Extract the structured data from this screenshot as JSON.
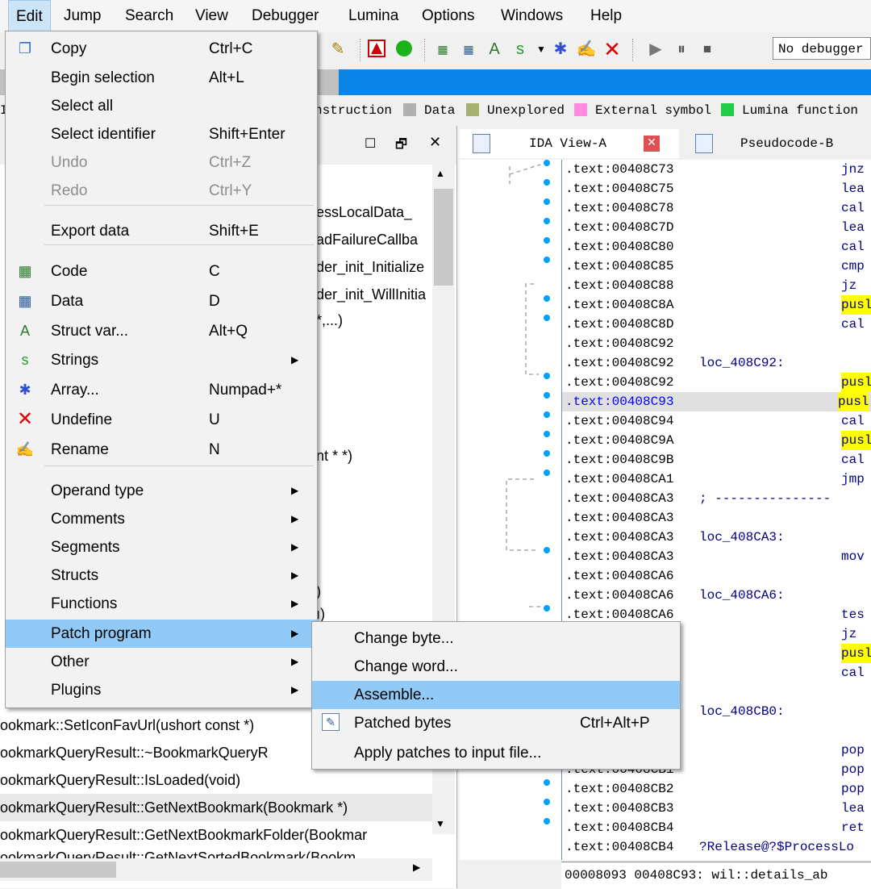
{
  "menubar": {
    "items": [
      "Edit",
      "Jump",
      "Search",
      "View",
      "Debugger",
      "Lumina",
      "Options",
      "Windows",
      "Help"
    ]
  },
  "toolbar": {
    "debugger_select": "No debugger"
  },
  "legend": {
    "items": [
      {
        "label": "nstruction",
        "color": "#c0c0c0"
      },
      {
        "label": "Data",
        "color": "#b0b0b0"
      },
      {
        "label": "Unexplored",
        "color": "#a8b070"
      },
      {
        "label": "External symbol",
        "color": "#ff8ce0"
      },
      {
        "label": "Lumina function",
        "color": "#22cc44"
      }
    ]
  },
  "functions_panel": {
    "partial_rows": [
      "essLocalData_",
      "adFailureCallba",
      "der_init_Initialize",
      "der_init_WillInitia",
      "*,...)",
      "nt * *)",
      ")",
      "ı)"
    ],
    "rows": [
      "ookmark::SetIconFavUrl(ushort const *)",
      "ookmarkQueryResult::~BookmarkQueryR",
      "ookmarkQueryResult::IsLoaded(void)",
      "ookmarkQueryResult::GetNextBookmark(Bookmark *)",
      "ookmarkQueryResult::GetNextBookmarkFolder(Bookmar",
      "ookmarkQueryResult::GetNextSortedBookmark(Bookm"
    ]
  },
  "tabs": [
    {
      "label": "IDA View-A"
    },
    {
      "label": "Pseudocode-B"
    }
  ],
  "code_lines": [
    {
      "addr": ".text:00408C73",
      "label": "",
      "mnem": "jnz",
      "hl": false
    },
    {
      "addr": ".text:00408C75",
      "label": "",
      "mnem": "lea",
      "hl": false
    },
    {
      "addr": ".text:00408C78",
      "label": "",
      "mnem": "cal",
      "hl": false
    },
    {
      "addr": ".text:00408C7D",
      "label": "",
      "mnem": "lea",
      "hl": false
    },
    {
      "addr": ".text:00408C80",
      "label": "",
      "mnem": "cal",
      "hl": false
    },
    {
      "addr": ".text:00408C85",
      "label": "",
      "mnem": "cmp",
      "hl": false
    },
    {
      "addr": ".text:00408C88",
      "label": "",
      "mnem": "jz",
      "hl": false
    },
    {
      "addr": ".text:00408C8A",
      "label": "",
      "mnem": "pusl",
      "hl": true
    },
    {
      "addr": ".text:00408C8D",
      "label": "",
      "mnem": "cal",
      "hl": false
    },
    {
      "addr": ".text:00408C92",
      "label": "",
      "mnem": "",
      "hl": false
    },
    {
      "addr": ".text:00408C92",
      "label": "loc_408C92:",
      "mnem": "",
      "hl": false
    },
    {
      "addr": ".text:00408C92",
      "label": "",
      "mnem": "pusl",
      "hl": true
    },
    {
      "addr": ".text:00408C93",
      "label": "",
      "mnem": "pusl",
      "hl": true,
      "sel": true
    },
    {
      "addr": ".text:00408C94",
      "label": "",
      "mnem": "cal",
      "hl": false
    },
    {
      "addr": ".text:00408C9A",
      "label": "",
      "mnem": "pusl",
      "hl": true
    },
    {
      "addr": ".text:00408C9B",
      "label": "",
      "mnem": "cal",
      "hl": false
    },
    {
      "addr": ".text:00408CA1",
      "label": "",
      "mnem": "jmp",
      "hl": false
    },
    {
      "addr": ".text:00408CA3",
      "label": "; ---------------",
      "mnem": "",
      "hl": false
    },
    {
      "addr": ".text:00408CA3",
      "label": "",
      "mnem": "",
      "hl": false
    },
    {
      "addr": ".text:00408CA3",
      "label": "loc_408CA3:",
      "mnem": "",
      "hl": false
    },
    {
      "addr": ".text:00408CA3",
      "label": "",
      "mnem": "mov",
      "hl": false
    },
    {
      "addr": ".text:00408CA6",
      "label": "",
      "mnem": "",
      "hl": false
    },
    {
      "addr": ".text:00408CA6",
      "label": "loc_408CA6:",
      "mnem": "",
      "hl": false
    },
    {
      "addr": ".text:00408CA6",
      "label": "",
      "mnem": "tes",
      "hl": false
    },
    {
      "addr": "8",
      "label": "",
      "mnem": "jz",
      "hl": false
    },
    {
      "addr": "A",
      "label": "",
      "mnem": "pusl",
      "hl": true
    },
    {
      "addr": "B",
      "label": "",
      "mnem": "cal",
      "hl": false
    },
    {
      "addr": "0",
      "label": "",
      "mnem": "",
      "hl": false
    },
    {
      "addr": "0",
      "label": "loc_408CB0:",
      "mnem": "",
      "hl": false
    },
    {
      "addr": "0",
      "label": "",
      "mnem": "",
      "hl": false
    },
    {
      "addr": "0",
      "label": "",
      "mnem": "pop",
      "hl": false
    },
    {
      "addr": ".text:00408CB1",
      "label": "",
      "mnem": "pop",
      "hl": false
    },
    {
      "addr": ".text:00408CB2",
      "label": "",
      "mnem": "pop",
      "hl": false
    },
    {
      "addr": ".text:00408CB3",
      "label": "",
      "mnem": "lea",
      "hl": false
    },
    {
      "addr": ".text:00408CB4",
      "label": "",
      "mnem": "ret",
      "hl": false
    },
    {
      "addr": ".text:00408CB4",
      "label": "?Release@?$ProcessLo",
      "mnem": "",
      "hl": false
    }
  ],
  "statusbar": "00008093 00408C93: wil::details_ab",
  "edit_menu": {
    "items": [
      {
        "label": "Copy",
        "shortcut": "Ctrl+C",
        "icon": "copy-icon",
        "disabled": false,
        "submenu": false
      },
      {
        "label": "Begin selection",
        "shortcut": "Alt+L",
        "icon": "",
        "disabled": false,
        "submenu": false
      },
      {
        "label": "Select all",
        "shortcut": "",
        "icon": "",
        "disabled": false,
        "submenu": false
      },
      {
        "label": "Select identifier",
        "shortcut": "Shift+Enter",
        "icon": "",
        "disabled": false,
        "submenu": false
      },
      {
        "label": "Undo",
        "shortcut": "Ctrl+Z",
        "icon": "",
        "disabled": true,
        "submenu": false
      },
      {
        "label": "Redo",
        "shortcut": "Ctrl+Y",
        "icon": "",
        "disabled": true,
        "submenu": false
      },
      {
        "label": "Export data",
        "shortcut": "Shift+E",
        "icon": "",
        "disabled": false,
        "submenu": false
      },
      {
        "label": "Code",
        "shortcut": "C",
        "icon": "code-icon",
        "disabled": false,
        "submenu": false
      },
      {
        "label": "Data",
        "shortcut": "D",
        "icon": "data-icon",
        "disabled": false,
        "submenu": false
      },
      {
        "label": "Struct var...",
        "shortcut": "Alt+Q",
        "icon": "struct-var-icon",
        "disabled": false,
        "submenu": false
      },
      {
        "label": "Strings",
        "shortcut": "",
        "icon": "strings-icon",
        "disabled": false,
        "submenu": true
      },
      {
        "label": "Array...",
        "shortcut": "Numpad+*",
        "icon": "array-icon",
        "disabled": false,
        "submenu": false
      },
      {
        "label": "Undefine",
        "shortcut": "U",
        "icon": "undefine-icon",
        "disabled": false,
        "submenu": false
      },
      {
        "label": "Rename",
        "shortcut": "N",
        "icon": "rename-icon",
        "disabled": false,
        "submenu": false
      },
      {
        "label": "Operand type",
        "shortcut": "",
        "icon": "",
        "disabled": false,
        "submenu": true
      },
      {
        "label": "Comments",
        "shortcut": "",
        "icon": "",
        "disabled": false,
        "submenu": true
      },
      {
        "label": "Segments",
        "shortcut": "",
        "icon": "",
        "disabled": false,
        "submenu": true
      },
      {
        "label": "Structs",
        "shortcut": "",
        "icon": "",
        "disabled": false,
        "submenu": true
      },
      {
        "label": "Functions",
        "shortcut": "",
        "icon": "",
        "disabled": false,
        "submenu": true
      },
      {
        "label": "Patch program",
        "shortcut": "",
        "icon": "",
        "disabled": false,
        "submenu": true
      },
      {
        "label": "Other",
        "shortcut": "",
        "icon": "",
        "disabled": false,
        "submenu": true
      },
      {
        "label": "Plugins",
        "shortcut": "",
        "icon": "",
        "disabled": false,
        "submenu": true
      }
    ]
  },
  "patch_submenu": {
    "items": [
      {
        "label": "Change byte...",
        "shortcut": "",
        "icon": ""
      },
      {
        "label": "Change word...",
        "shortcut": "",
        "icon": ""
      },
      {
        "label": "Assemble...",
        "shortcut": "",
        "icon": ""
      },
      {
        "label": "Patched bytes",
        "shortcut": "Ctrl+Alt+P",
        "icon": "patched-bytes-icon"
      },
      {
        "label": "Apply patches to input file...",
        "shortcut": "",
        "icon": ""
      }
    ]
  }
}
